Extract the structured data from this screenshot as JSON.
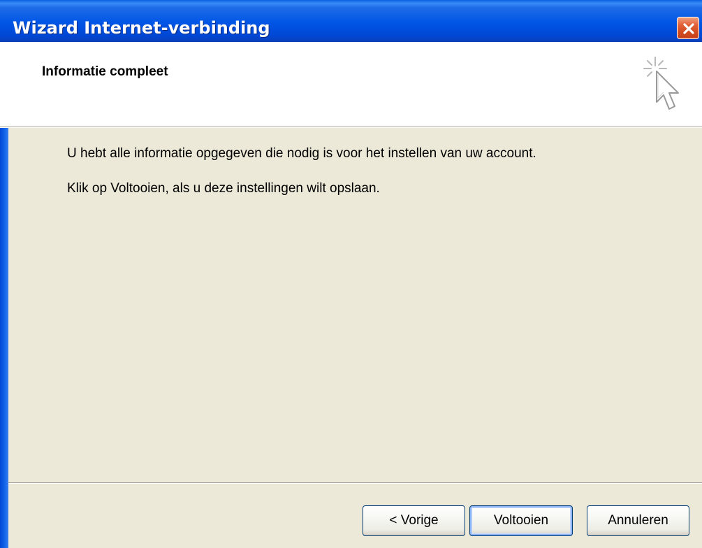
{
  "window": {
    "title": "Wizard Internet-verbinding",
    "close_icon": "close-icon"
  },
  "header": {
    "title": "Informatie compleet",
    "icon": "wizard-cursor-sparkle-icon"
  },
  "content": {
    "line1": "U hebt alle informatie opgegeven die nodig is voor het instellen van uw account.",
    "line2": "Klik op Voltooien, als u deze instellingen wilt opslaan."
  },
  "buttons": {
    "prev": "< Vorige",
    "finish": "Voltooien",
    "cancel": "Annuleren"
  },
  "colors": {
    "titlebar": "#0055E5",
    "close_button": "#E2613A",
    "dialog_background": "#ECE9D8",
    "header_background": "#FFFFFF",
    "default_button_focus": "#8FB4F5"
  }
}
